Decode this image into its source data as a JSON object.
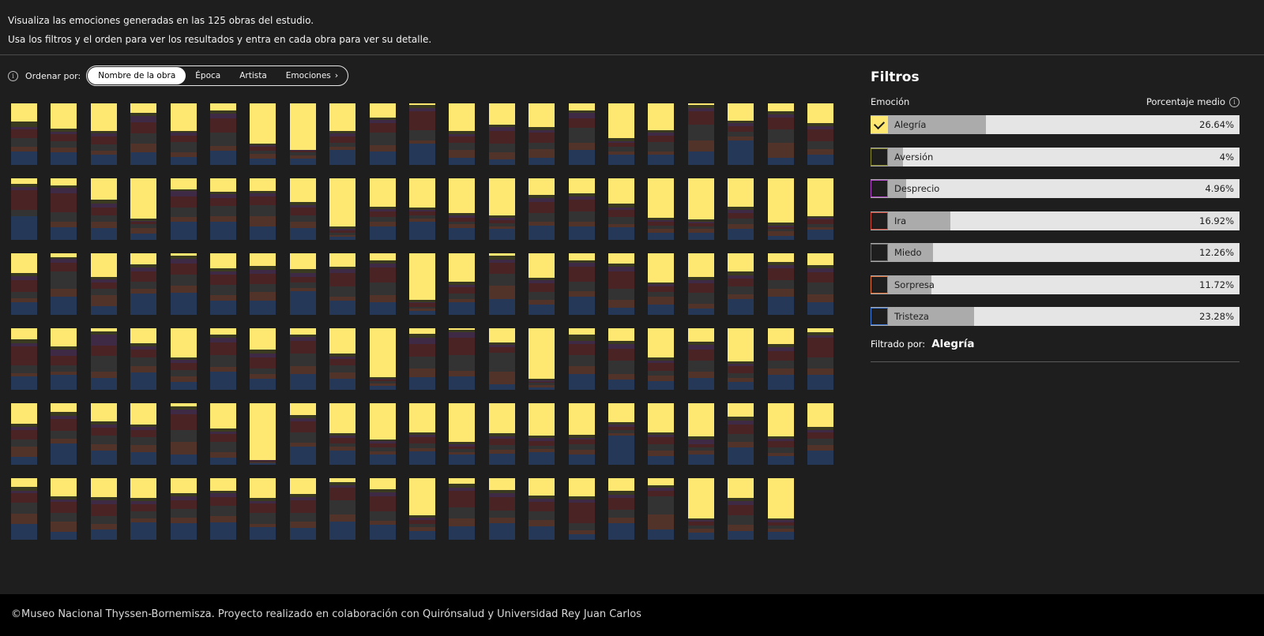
{
  "intro": {
    "line1": "Visualiza las emociones generadas en las 125 obras del estudio.",
    "line2": "Usa los filtros y el orden para ver los resultados y entra en cada obra para ver su detalle."
  },
  "sort": {
    "label": "Ordenar por:",
    "options": [
      "Nombre de la obra",
      "Época",
      "Artista",
      "Emociones"
    ],
    "active": "Nombre de la obra"
  },
  "colors": {
    "alegria": "#ffe872",
    "aversion": "#3a3a20",
    "desprecio": "#3e2a45",
    "ira": "#4a2424",
    "miedo": "#333333",
    "sorpresa": "#52332a",
    "tristeza": "#253857"
  },
  "artworks": [
    {
      "emotions": [
        30,
        8,
        4,
        15,
        13,
        8,
        22
      ]
    },
    {
      "emotions": [
        41,
        5,
        4,
        12,
        10,
        8,
        20
      ]
    },
    {
      "emotions": [
        45,
        4,
        5,
        13,
        10,
        6,
        17
      ]
    },
    {
      "emotions": [
        16,
        4,
        11,
        18,
        17,
        13,
        21
      ]
    },
    {
      "emotions": [
        45,
        3,
        5,
        10,
        17,
        7,
        13
      ]
    },
    {
      "emotions": [
        11,
        6,
        8,
        23,
        21,
        8,
        23
      ]
    },
    {
      "emotions": [
        65,
        3,
        2,
        7,
        5,
        8,
        10
      ]
    },
    {
      "emotions": [
        75,
        0,
        2,
        3,
        5,
        5,
        10
      ]
    },
    {
      "emotions": [
        45,
        4,
        5,
        10,
        7,
        5,
        24
      ]
    },
    {
      "emotions": [
        23,
        4,
        5,
        16,
        20,
        10,
        22
      ]
    },
    {
      "emotions": [
        3,
        5,
        5,
        31,
        16,
        6,
        34
      ]
    },
    {
      "emotions": [
        45,
        5,
        4,
        10,
        12,
        12,
        12
      ]
    },
    {
      "emotions": [
        35,
        4,
        6,
        20,
        15,
        11,
        9
      ]
    },
    {
      "emotions": [
        39,
        5,
        4,
        16,
        10,
        14,
        12
      ]
    },
    {
      "emotions": [
        11,
        5,
        8,
        16,
        24,
        12,
        24
      ]
    },
    {
      "emotions": [
        56,
        5,
        3,
        7,
        7,
        6,
        16
      ]
    },
    {
      "emotions": [
        44,
        4,
        5,
        10,
        15,
        6,
        16
      ]
    },
    {
      "emotions": [
        2,
        6,
        5,
        22,
        25,
        18,
        22
      ]
    },
    {
      "emotions": [
        28,
        4,
        5,
        9,
        8,
        6,
        40
      ]
    },
    {
      "emotions": [
        13,
        5,
        5,
        19,
        22,
        24,
        12
      ]
    },
    {
      "emotions": [
        32,
        5,
        5,
        20,
        12,
        9,
        17
      ]
    },
    {
      "emotions": [
        9,
        5,
        5,
        32,
        10,
        0,
        39
      ]
    },
    {
      "emotions": [
        11,
        5,
        8,
        31,
        16,
        9,
        20
      ]
    },
    {
      "emotions": [
        34,
        7,
        7,
        12,
        11,
        10,
        19
      ]
    },
    {
      "emotions": [
        66,
        3,
        2,
        4,
        6,
        9,
        10
      ]
    },
    {
      "emotions": [
        18,
        3,
        8,
        19,
        15,
        7,
        30
      ]
    },
    {
      "emotions": [
        22,
        4,
        6,
        13,
        17,
        9,
        29
      ]
    },
    {
      "emotions": [
        20,
        5,
        5,
        14,
        18,
        16,
        22
      ]
    },
    {
      "emotions": [
        38,
        5,
        5,
        12,
        11,
        10,
        19
      ]
    },
    {
      "emotions": [
        78,
        4,
        3,
        3,
        4,
        3,
        5
      ]
    },
    {
      "emotions": [
        46,
        4,
        4,
        9,
        8,
        7,
        22
      ]
    },
    {
      "emotions": [
        48,
        3,
        3,
        6,
        6,
        5,
        29
      ]
    },
    {
      "emotions": [
        56,
        4,
        4,
        6,
        5,
        6,
        19
      ]
    },
    {
      "emotions": [
        60,
        4,
        4,
        5,
        5,
        4,
        18
      ]
    },
    {
      "emotions": [
        27,
        5,
        6,
        18,
        14,
        7,
        23
      ]
    },
    {
      "emotions": [
        24,
        5,
        6,
        19,
        16,
        8,
        22
      ]
    },
    {
      "emotions": [
        41,
        6,
        4,
        12,
        11,
        5,
        21
      ]
    },
    {
      "emotions": [
        64,
        4,
        3,
        6,
        5,
        6,
        12
      ]
    },
    {
      "emotions": [
        67,
        3,
        3,
        5,
        4,
        6,
        12
      ]
    },
    {
      "emotions": [
        46,
        5,
        5,
        10,
        9,
        7,
        18
      ]
    },
    {
      "emotions": [
        72,
        5,
        3,
        2,
        4,
        8,
        6
      ]
    },
    {
      "emotions": [
        61,
        3,
        3,
        7,
        5,
        5,
        16
      ]
    },
    {
      "emotions": [
        32,
        5,
        6,
        20,
        10,
        7,
        20
      ]
    },
    {
      "emotions": [
        6,
        3,
        7,
        14,
        28,
        12,
        30
      ]
    },
    {
      "emotions": [
        38,
        4,
        5,
        11,
        10,
        18,
        14
      ]
    },
    {
      "emotions": [
        18,
        5,
        7,
        16,
        12,
        7,
        35
      ]
    },
    {
      "emotions": [
        4,
        5,
        8,
        18,
        17,
        12,
        36
      ]
    },
    {
      "emotions": [
        24,
        5,
        6,
        16,
        17,
        9,
        23
      ]
    },
    {
      "emotions": [
        21,
        6,
        6,
        17,
        13,
        14,
        23
      ]
    },
    {
      "emotions": [
        26,
        6,
        6,
        10,
        9,
        5,
        38
      ]
    },
    {
      "emotions": [
        22,
        4,
        6,
        22,
        17,
        6,
        23
      ]
    },
    {
      "emotions": [
        11,
        6,
        6,
        24,
        21,
        11,
        21
      ]
    },
    {
      "emotions": [
        76,
        3,
        2,
        6,
        3,
        4,
        6
      ]
    },
    {
      "emotions": [
        46,
        5,
        4,
        11,
        8,
        6,
        20
      ]
    },
    {
      "emotions": [
        4,
        6,
        6,
        17,
        20,
        21,
        26
      ]
    },
    {
      "emotions": [
        40,
        4,
        5,
        14,
        13,
        8,
        16
      ]
    },
    {
      "emotions": [
        11,
        5,
        6,
        24,
        16,
        9,
        29
      ]
    },
    {
      "emotions": [
        17,
        5,
        7,
        29,
        18,
        13,
        11
      ]
    },
    {
      "emotions": [
        47,
        3,
        4,
        9,
        7,
        14,
        16
      ]
    },
    {
      "emotions": [
        38,
        6,
        5,
        15,
        18,
        8,
        10
      ]
    },
    {
      "emotions": [
        30,
        6,
        5,
        13,
        13,
        8,
        25
      ]
    },
    {
      "emotions": [
        14,
        5,
        5,
        20,
        14,
        12,
        30
      ]
    },
    {
      "emotions": [
        19,
        5,
        7,
        17,
        19,
        12,
        21
      ]
    },
    {
      "emotions": [
        18,
        6,
        6,
        30,
        13,
        5,
        22
      ]
    },
    {
      "emotions": [
        29,
        6,
        10,
        15,
        10,
        6,
        24
      ]
    },
    {
      "emotions": [
        5,
        5,
        18,
        17,
        25,
        11,
        19
      ]
    },
    {
      "emotions": [
        24,
        5,
        5,
        14,
        14,
        10,
        28
      ]
    },
    {
      "emotions": [
        47,
        4,
        5,
        12,
        10,
        9,
        13
      ]
    },
    {
      "emotions": [
        10,
        5,
        8,
        20,
        20,
        8,
        29
      ]
    },
    {
      "emotions": [
        35,
        6,
        6,
        18,
        9,
        8,
        18
      ]
    },
    {
      "emotions": [
        10,
        4,
        7,
        20,
        20,
        13,
        26
      ]
    },
    {
      "emotions": [
        41,
        5,
        4,
        10,
        12,
        10,
        18
      ]
    },
    {
      "emotions": [
        79,
        3,
        2,
        2,
        4,
        4,
        6
      ]
    },
    {
      "emotions": [
        9,
        6,
        11,
        20,
        19,
        14,
        21
      ]
    },
    {
      "emotions": [
        3,
        4,
        8,
        28,
        26,
        9,
        22
      ]
    },
    {
      "emotions": [
        23,
        4,
        4,
        9,
        31,
        20,
        9
      ]
    },
    {
      "emotions": [
        82,
        3,
        2,
        2,
        3,
        4,
        4
      ]
    },
    {
      "emotions": [
        10,
        10,
        6,
        17,
        19,
        12,
        26
      ]
    },
    {
      "emotions": [
        20,
        6,
        7,
        20,
        21,
        9,
        17
      ]
    },
    {
      "emotions": [
        48,
        5,
        4,
        12,
        8,
        9,
        14
      ]
    },
    {
      "emotions": [
        22,
        5,
        7,
        18,
        18,
        11,
        19
      ]
    },
    {
      "emotions": [
        54,
        4,
        4,
        11,
        8,
        6,
        13
      ]
    },
    {
      "emotions": [
        26,
        5,
        6,
        16,
        13,
        10,
        24
      ]
    },
    {
      "emotions": [
        7,
        4,
        4,
        32,
        18,
        11,
        24
      ]
    },
    {
      "emotions": [
        33,
        5,
        6,
        15,
        12,
        16,
        13
      ]
    },
    {
      "emotions": [
        14,
        6,
        6,
        19,
        13,
        8,
        34
      ]
    },
    {
      "emotions": [
        30,
        5,
        5,
        13,
        14,
        10,
        23
      ]
    },
    {
      "emotions": [
        34,
        5,
        5,
        11,
        13,
        11,
        21
      ]
    },
    {
      "emotions": [
        5,
        5,
        8,
        25,
        20,
        20,
        17
      ]
    },
    {
      "emotions": [
        41,
        5,
        4,
        13,
        16,
        9,
        12
      ]
    },
    {
      "emotions": [
        92,
        0,
        1,
        2,
        1,
        2,
        2
      ]
    },
    {
      "emotions": [
        19,
        6,
        5,
        18,
        16,
        7,
        29
      ]
    },
    {
      "emotions": [
        49,
        4,
        4,
        8,
        6,
        6,
        23
      ]
    },
    {
      "emotions": [
        59,
        3,
        4,
        6,
        6,
        5,
        17
      ]
    },
    {
      "emotions": [
        47,
        4,
        4,
        11,
        7,
        5,
        22
      ]
    },
    {
      "emotions": [
        63,
        4,
        3,
        5,
        4,
        4,
        17
      ]
    },
    {
      "emotions": [
        49,
        5,
        4,
        10,
        8,
        6,
        18
      ]
    },
    {
      "emotions": [
        52,
        5,
        4,
        8,
        6,
        5,
        20
      ]
    },
    {
      "emotions": [
        51,
        5,
        3,
        8,
        9,
        7,
        17
      ]
    },
    {
      "emotions": [
        31,
        4,
        4,
        5,
        5,
        3,
        48
      ]
    },
    {
      "emotions": [
        47,
        4,
        4,
        12,
        10,
        9,
        14
      ]
    },
    {
      "emotions": [
        54,
        5,
        8,
        5,
        5,
        7,
        16
      ]
    },
    {
      "emotions": [
        22,
        6,
        6,
        16,
        13,
        9,
        28
      ]
    },
    {
      "emotions": [
        54,
        4,
        4,
        10,
        9,
        5,
        14
      ]
    },
    {
      "emotions": [
        38,
        5,
        4,
        11,
        10,
        9,
        23
      ]
    },
    {
      "emotions": [
        14,
        6,
        5,
        15,
        18,
        17,
        25
      ]
    },
    {
      "emotions": [
        29,
        5,
        5,
        17,
        15,
        16,
        13
      ]
    },
    {
      "emotions": [
        31,
        5,
        6,
        19,
        13,
        9,
        17
      ]
    },
    {
      "emotions": [
        32,
        5,
        5,
        12,
        11,
        7,
        28
      ]
    },
    {
      "emotions": [
        24,
        6,
        6,
        14,
        14,
        9,
        27
      ]
    },
    {
      "emotions": [
        20,
        5,
        6,
        14,
        17,
        10,
        28
      ]
    },
    {
      "emotions": [
        32,
        5,
        4,
        15,
        19,
        5,
        20
      ]
    },
    {
      "emotions": [
        26,
        5,
        5,
        21,
        14,
        10,
        19
      ]
    },
    {
      "emotions": [
        6,
        5,
        5,
        20,
        23,
        11,
        30
      ]
    },
    {
      "emotions": [
        18,
        5,
        7,
        24,
        15,
        7,
        24
      ]
    },
    {
      "emotions": [
        60,
        4,
        4,
        6,
        5,
        7,
        14
      ]
    },
    {
      "emotions": [
        9,
        6,
        6,
        26,
        19,
        12,
        22
      ]
    },
    {
      "emotions": [
        19,
        6,
        6,
        21,
        12,
        9,
        27
      ]
    },
    {
      "emotions": [
        28,
        5,
        6,
        15,
        14,
        10,
        22
      ]
    },
    {
      "emotions": [
        29,
        5,
        6,
        33,
        12,
        6,
        9
      ]
    },
    {
      "emotions": [
        21,
        6,
        5,
        19,
        13,
        9,
        27
      ]
    },
    {
      "emotions": [
        11,
        5,
        5,
        8,
        30,
        24,
        17
      ]
    },
    {
      "emotions": [
        65,
        3,
        3,
        6,
        5,
        6,
        12
      ]
    },
    {
      "emotions": [
        32,
        5,
        6,
        17,
        16,
        10,
        14
      ]
    },
    {
      "emotions": [
        65,
        3,
        4,
        5,
        5,
        5,
        13
      ]
    }
  ],
  "filters": {
    "title": "Filtros",
    "col_emotion": "Emoción",
    "col_avg": "Porcentaje medio",
    "items": [
      {
        "name": "Alegría",
        "pct": "26.64%",
        "value": 26.64,
        "color": "#ffe872",
        "checked": true
      },
      {
        "name": "Aversión",
        "pct": "4%",
        "value": 4.0,
        "color": "#8a8a2a",
        "checked": false
      },
      {
        "name": "Desprecio",
        "pct": "4.96%",
        "value": 4.96,
        "color": "#b449c9",
        "checked": false
      },
      {
        "name": "Ira",
        "pct": "16.92%",
        "value": 16.92,
        "color": "#d24a3a",
        "checked": false
      },
      {
        "name": "Miedo",
        "pct": "12.26%",
        "value": 12.26,
        "color": "#6b6b6b",
        "checked": false
      },
      {
        "name": "Sorpresa",
        "pct": "11.72%",
        "value": 11.72,
        "color": "#e0723a",
        "checked": false
      },
      {
        "name": "Tristeza",
        "pct": "23.28%",
        "value": 23.28,
        "color": "#3e7bdb",
        "checked": false
      }
    ],
    "filtered_label": "Filtrado por:",
    "filtered_value": "Alegría"
  },
  "footer": {
    "text": "©Museo Nacional Thyssen-Bornemisza. Proyecto realizado en colaboración con Quirónsalud y Universidad Rey Juan Carlos"
  }
}
